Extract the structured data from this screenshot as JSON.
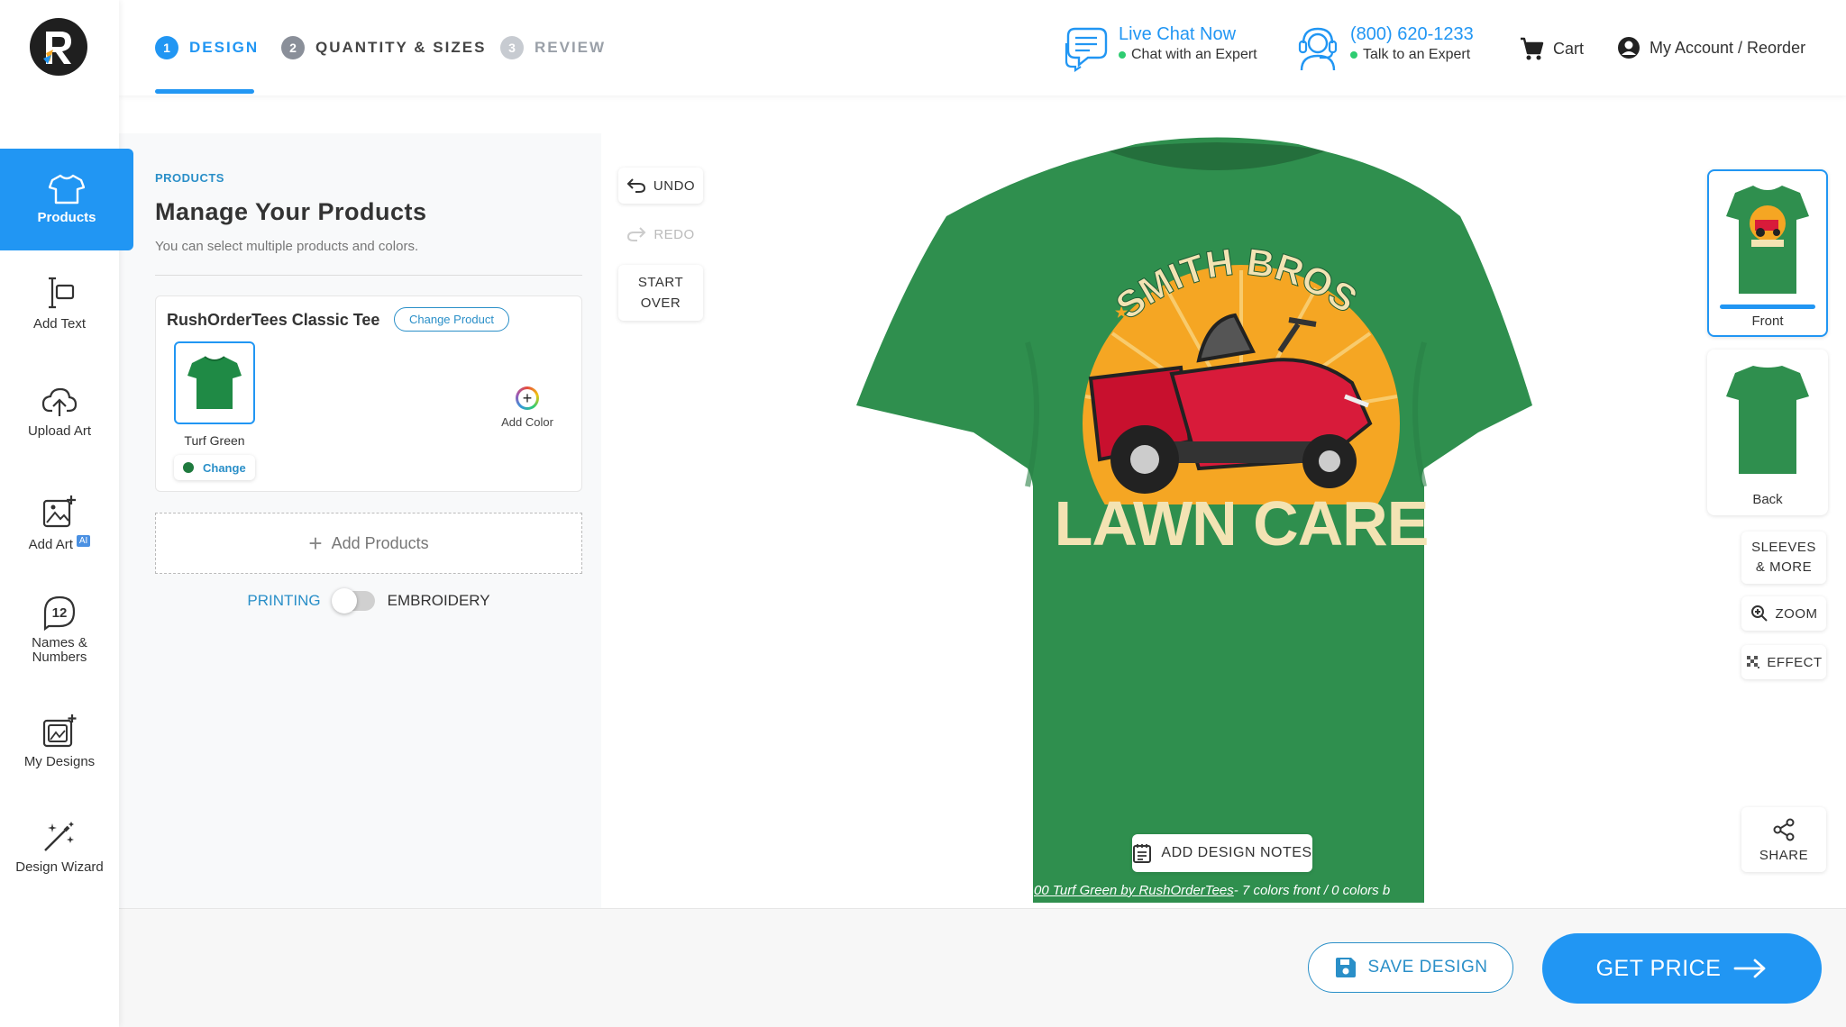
{
  "steps": [
    {
      "num": "1",
      "label": "DESIGN"
    },
    {
      "num": "2",
      "label": "QUANTITY & SIZES"
    },
    {
      "num": "3",
      "label": "REVIEW"
    }
  ],
  "header": {
    "chat_title": "Live Chat Now",
    "chat_sub": "Chat with an Expert",
    "phone_title": "(800) 620-1233",
    "phone_sub": "Talk to an Expert",
    "cart": "Cart",
    "account": "My Account / Reorder"
  },
  "sidebar": {
    "items": [
      {
        "label": "Products",
        "icon": "tshirt-icon"
      },
      {
        "label": "Add Text",
        "icon": "text-cursor-icon"
      },
      {
        "label": "Upload Art",
        "icon": "cloud-upload-icon"
      },
      {
        "label": "Add Art",
        "icon": "image-plus-icon",
        "badge": "AI"
      },
      {
        "label": "Names & Numbers",
        "icon": "number-badge-icon",
        "badge_number": "12"
      },
      {
        "label": "My Designs",
        "icon": "gallery-icon"
      },
      {
        "label": "Design Wizard",
        "icon": "magic-wand-icon"
      }
    ]
  },
  "panel": {
    "section_label": "PRODUCTS",
    "title": "Manage Your Products",
    "subtitle": "You can select multiple products and colors.",
    "product_name": "RushOrderTees Classic Tee",
    "change_product": "Change Product",
    "color_name": "Turf Green",
    "change_label": "Change",
    "add_color": "Add Color",
    "add_products": "Add Products",
    "printing": "PRINTING",
    "embroidery": "EMBROIDERY"
  },
  "tools": {
    "undo": "UNDO",
    "redo": "REDO",
    "start_over_1": "START",
    "start_over_2": "OVER"
  },
  "design": {
    "top_text": "SMITH BROS.",
    "bottom_text": "LAWN CARE",
    "shirt_color": "#2f8f4e",
    "sun_color": "#f5a623",
    "text_color": "#f3e3b3",
    "add_notes": "ADD DESIGN NOTES",
    "caption_link": "00 Turf Green by RushOrderTees",
    "caption_rest": "- 7 colors front   /  0 colors b"
  },
  "views": {
    "front": "Front",
    "back": "Back",
    "sleeves_1": "SLEEVES",
    "sleeves_2": "& MORE",
    "zoom": "ZOOM",
    "effect": "EFFECT",
    "share": "SHARE"
  },
  "footer": {
    "save": "SAVE DESIGN",
    "price": "GET PRICE"
  }
}
